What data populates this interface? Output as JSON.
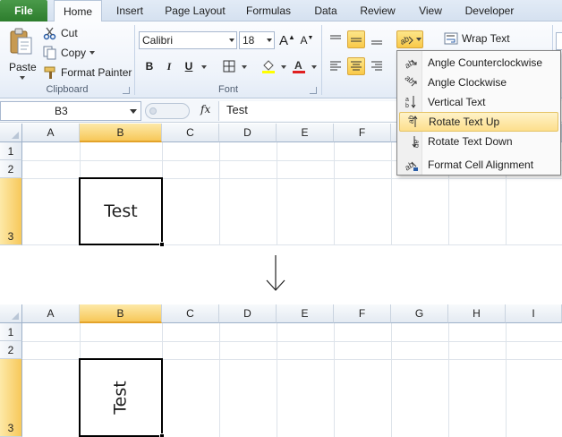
{
  "tabs": [
    {
      "label": "File"
    },
    {
      "label": "Home"
    },
    {
      "label": "Insert"
    },
    {
      "label": "Page Layout"
    },
    {
      "label": "Formulas"
    },
    {
      "label": "Data"
    },
    {
      "label": "Review"
    },
    {
      "label": "View"
    },
    {
      "label": "Developer"
    }
  ],
  "clipboard": {
    "paste_label": "Paste",
    "cut_label": "Cut",
    "copy_label": "Copy",
    "format_painter_label": "Format Painter",
    "group_label": "Clipboard"
  },
  "font": {
    "name": "Calibri",
    "size": "18",
    "group_label": "Font",
    "bold": "B",
    "italic": "I",
    "underline": "U"
  },
  "alignment": {
    "wrap_text_label": "Wrap Text"
  },
  "formula_bar": {
    "name_box": "B3",
    "fx": "fx",
    "value": "Test"
  },
  "orientation_menu": {
    "items": [
      {
        "label": "Angle Counterclockwise",
        "icon": "angle-ccw-icon"
      },
      {
        "label": "Angle Clockwise",
        "icon": "angle-cw-icon"
      },
      {
        "label": "Vertical Text",
        "icon": "vertical-text-icon"
      },
      {
        "label": "Rotate Text Up",
        "icon": "rotate-up-icon",
        "highlighted": true
      },
      {
        "label": "Rotate Text Down",
        "icon": "rotate-down-icon"
      },
      {
        "label": "Format Cell Alignment",
        "icon": "format-alignment-icon"
      }
    ]
  },
  "grid_top": {
    "columns": [
      "A",
      "B",
      "C",
      "D",
      "E",
      "F"
    ],
    "rows": [
      "1",
      "2",
      "3"
    ],
    "selected_cell_text": "Test"
  },
  "grid_bottom": {
    "columns": [
      "A",
      "B",
      "C",
      "D",
      "E",
      "F",
      "G",
      "H",
      "I"
    ],
    "rows": [
      "1",
      "2",
      "3"
    ],
    "selected_cell_text": "Test"
  },
  "colors": {
    "file_tab": "#2d7d2d",
    "selection_header": "#f7c85a",
    "menu_highlight": "#fddf8c"
  }
}
